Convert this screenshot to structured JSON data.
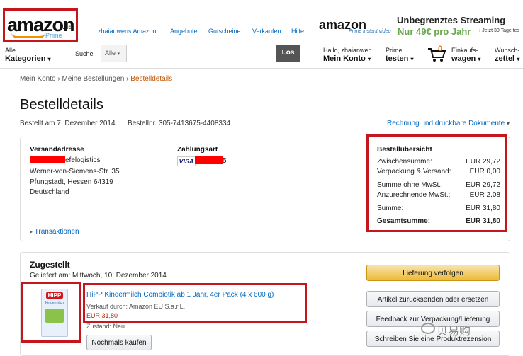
{
  "header": {
    "logo_text": "amazon",
    "logo_tld": ".de",
    "logo_prime": "Prime",
    "nav_links": [
      "zhaianwens Amazon",
      "Angebote",
      "Gutscheine",
      "Verkaufen",
      "Hilfe"
    ],
    "ad": {
      "brand": "amazon",
      "prime": "Prime instant video",
      "title": "Unbegrenztes Streaming",
      "price": "Nur 49€ pro Jahr",
      "cta": "› Jetzt 30 Tage tes"
    }
  },
  "nav": {
    "categories_small": "Alle",
    "categories_big": "Kategorien",
    "search_label": "Suche",
    "search_category": "Alle",
    "search_placeholder": "",
    "search_button": "Los",
    "account_small": "Hallo, zhaianwen",
    "account_big": "Mein Konto",
    "prime_small": "Prime",
    "prime_big": "testen",
    "cart_count": "0",
    "cart_small": "Einkaufs-",
    "cart_big": "wagen",
    "wish_small": "Wunsch-",
    "wish_big": "zettel"
  },
  "breadcrumb": [
    "Mein Konto",
    "Meine Bestellungen",
    "Bestelldetails"
  ],
  "page": {
    "title": "Bestelldetails",
    "ordered_on": "Bestellt am 7. Dezember 2014",
    "order_number": "Bestellnr. 305-7413675-4408334",
    "invoice_link": "Rechnung und druckbare Dokumente"
  },
  "shipping": {
    "heading": "Versandadresse",
    "line1": "efelogistics",
    "line2": "Werner-von-Siemens-Str. 35",
    "line3": "Pfungstadt, Hessen 64319",
    "line4": "Deutschland",
    "transactions_link": "Transaktionen"
  },
  "payment": {
    "heading": "Zahlungsart",
    "card_brand": "VISA",
    "card_suffix": "5"
  },
  "summary": {
    "heading": "Bestellübersicht",
    "rows": [
      {
        "label": "Zwischensumme:",
        "value": "EUR 29,72"
      },
      {
        "label": "Verpackung & Versand:",
        "value": "EUR 0,00"
      },
      {
        "label": "Summe ohne MwSt.:",
        "value": "EUR 29,72"
      },
      {
        "label": "Anzurechnende MwSt.:",
        "value": "EUR 2,08"
      },
      {
        "label": "Summe:",
        "value": "EUR 31,80"
      }
    ],
    "total_label": "Gesamtsumme:",
    "total_value": "EUR 31,80"
  },
  "shipment": {
    "status": "Zugestellt",
    "delivered": "Geliefert am: Mittwoch, 10. Dezember 2014",
    "product_title": "HiPP Kindermilch Combiotik ab 1 Jahr, 4er Pack (4 x 600 g)",
    "sold_by": "Verkauf durch: Amazon EU S.a.r.L.",
    "price": "EUR 31,80",
    "condition": "Zustand: Neu",
    "buy_again": "Nochmals kaufen",
    "product_brand": "HiPP",
    "product_name": "Kindermilch"
  },
  "actions": {
    "track": "Lieferung verfolgen",
    "return": "Artikel zurücksenden oder ersetzen",
    "feedback": "Feedback zur Verpackung/Lieferung",
    "review": "Schreiben Sie eine Produktrezension"
  },
  "watermark": "贝易购",
  "colors": {
    "highlight_red": "#c4161c",
    "link_blue": "#0066c0",
    "breadcrumb_orange": "#c45500",
    "button_yellow": "#eeba37",
    "redaction": "#ff0000"
  }
}
